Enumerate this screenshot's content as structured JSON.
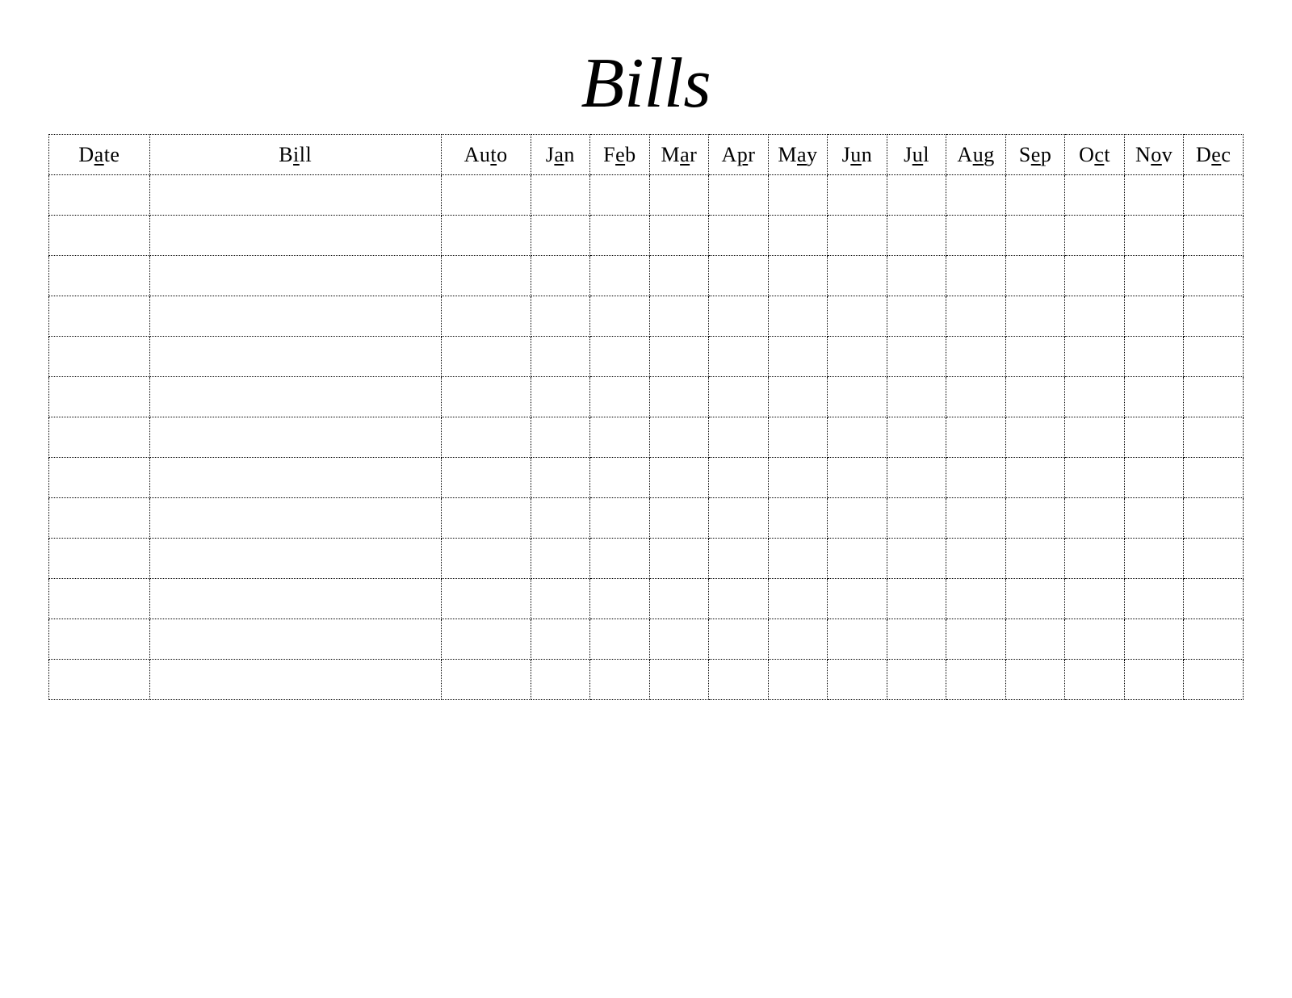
{
  "title": "Bills",
  "columns": [
    {
      "key": "date",
      "start": "D",
      "under": "a",
      "rest": "te"
    },
    {
      "key": "bill",
      "start": "B",
      "under": "i",
      "rest": "ll"
    },
    {
      "key": "auto",
      "start": "Au",
      "under": "t",
      "rest": "o"
    },
    {
      "key": "jan",
      "start": "J",
      "under": "a",
      "rest": "n"
    },
    {
      "key": "feb",
      "start": "F",
      "under": "e",
      "rest": "b"
    },
    {
      "key": "mar",
      "start": "M",
      "under": "a",
      "rest": "r"
    },
    {
      "key": "apr",
      "start": "A",
      "under": "p",
      "rest": "r"
    },
    {
      "key": "may",
      "start": "M",
      "under": "a",
      "rest": "y"
    },
    {
      "key": "jun",
      "start": "J",
      "under": "u",
      "rest": "n"
    },
    {
      "key": "jul",
      "start": "J",
      "under": "u",
      "rest": "l"
    },
    {
      "key": "aug",
      "start": "A",
      "under": "u",
      "rest": "g"
    },
    {
      "key": "sep",
      "start": "S",
      "under": "e",
      "rest": "p"
    },
    {
      "key": "oct",
      "start": "O",
      "under": "c",
      "rest": "t"
    },
    {
      "key": "nov",
      "start": "N",
      "under": "o",
      "rest": "v"
    },
    {
      "key": "dec",
      "start": "D",
      "under": "e",
      "rest": "c"
    }
  ],
  "row_count": 13
}
